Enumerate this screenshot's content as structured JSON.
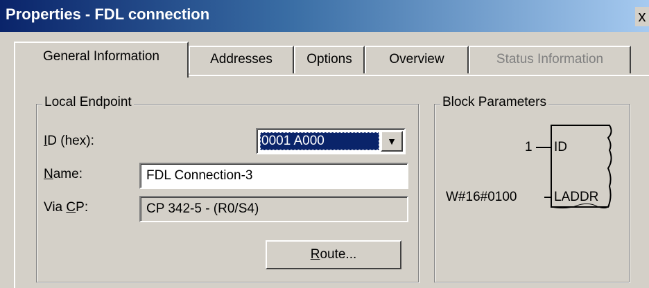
{
  "window": {
    "title": "Properties - FDL connection",
    "close_symbol": "x"
  },
  "tabs": [
    {
      "label": "General Information",
      "active": true,
      "enabled": true
    },
    {
      "label": "Addresses",
      "active": false,
      "enabled": true
    },
    {
      "label": "Options",
      "active": false,
      "enabled": true
    },
    {
      "label": "Overview",
      "active": false,
      "enabled": true
    },
    {
      "label": "Status Information",
      "active": false,
      "enabled": false
    }
  ],
  "local_endpoint": {
    "title": "Local Endpoint",
    "id_label_key": "I",
    "id_label_rest": "D (hex):",
    "id_value": "0001 A000",
    "name_label_key": "N",
    "name_label_rest": "ame:",
    "name_value": "FDL Connection-3",
    "via_cp_label_pre": "Via ",
    "via_cp_label_key": "C",
    "via_cp_label_post": "P:",
    "via_cp_value": "CP 342-5 - (R0/S4)",
    "route_button_key": "R",
    "route_button_rest": "oute..."
  },
  "block_parameters": {
    "title": "Block Parameters",
    "inputs": [
      {
        "value": "1",
        "pin": "ID"
      },
      {
        "value": "W#16#0100",
        "pin": "LADDR"
      }
    ]
  },
  "colors": {
    "title_gradient_start": "#0a246a",
    "title_gradient_end": "#a6caf0",
    "selection": "#0a246a",
    "face": "#d4d0c8"
  }
}
